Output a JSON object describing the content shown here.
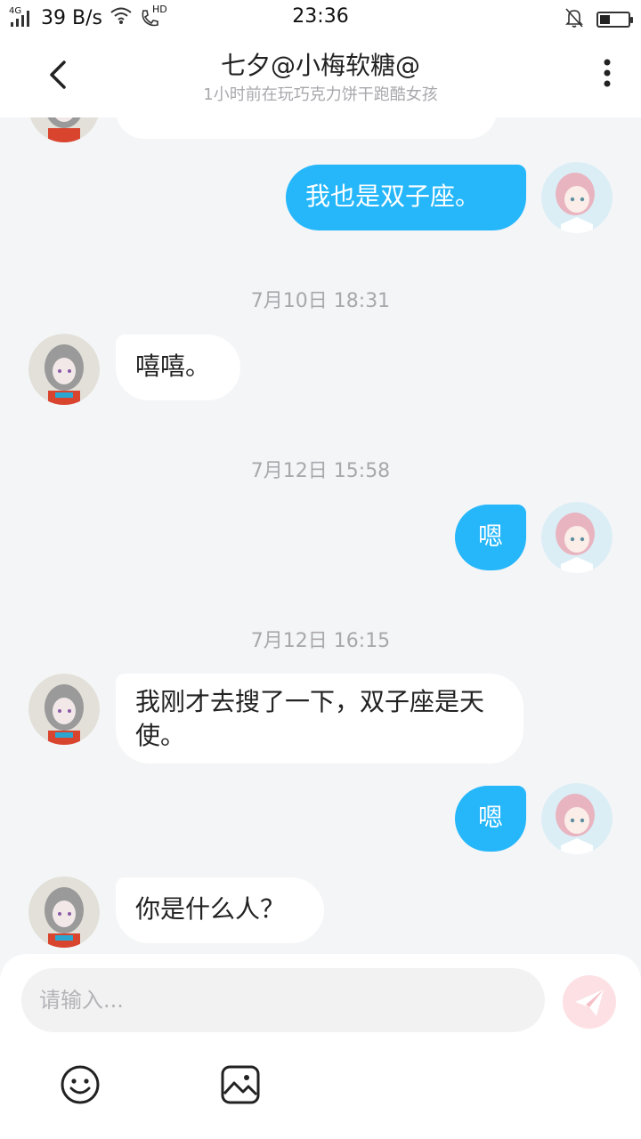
{
  "status_bar": {
    "network": "4G",
    "speed": "39 B/s",
    "hd": "HD",
    "time": "23:36",
    "battery_level": 0.35
  },
  "header": {
    "title": "七夕@小梅软糖@",
    "subtitle": "1小时前在玩巧克力饼干跑酷女孩"
  },
  "messages": [
    {
      "side": "left",
      "text": "",
      "partial": true
    },
    {
      "side": "right",
      "text": "我也是双子座。"
    },
    {
      "type": "timestamp",
      "text": "7月10日 18:31"
    },
    {
      "side": "left",
      "text": "嘻嘻。"
    },
    {
      "type": "timestamp",
      "text": "7月12日 15:58"
    },
    {
      "side": "right",
      "text": "嗯"
    },
    {
      "type": "timestamp",
      "text": "7月12日 16:15"
    },
    {
      "side": "left",
      "text": "我刚才去搜了一下，双子座是天使。"
    },
    {
      "side": "right",
      "text": "嗯"
    },
    {
      "side": "left",
      "text": "你是什么人？"
    }
  ],
  "input": {
    "placeholder": "请输入..."
  },
  "icons": {
    "back": "back-arrow-icon",
    "more": "more-vertical-icon",
    "send": "send-icon",
    "emoji": "emoji-icon",
    "image": "image-icon"
  },
  "colors": {
    "accent": "#26b7fb",
    "background": "#f4f5f7",
    "send_disabled": "#fde0e4"
  }
}
